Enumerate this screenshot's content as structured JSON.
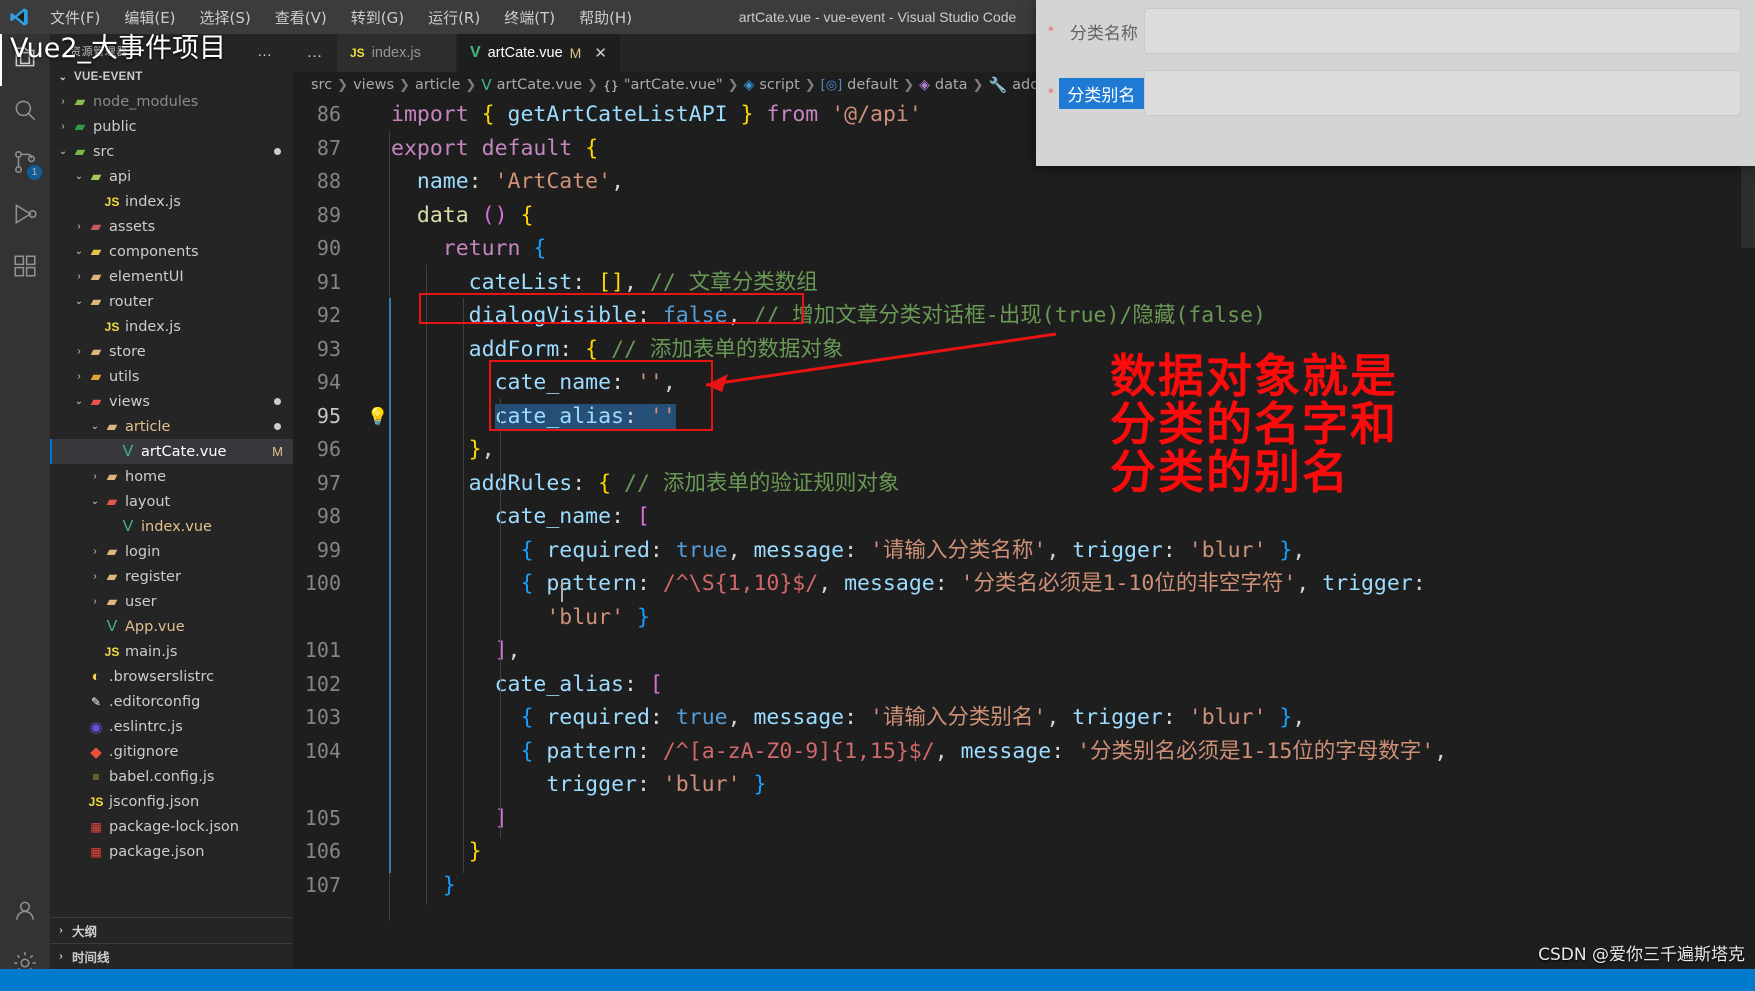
{
  "window": {
    "title": "artCate.vue - vue-event - Visual Studio Code",
    "logo_icon": "vscode-logo-icon"
  },
  "menubar": {
    "items": [
      {
        "label": "文件(F)",
        "name": "menu-file"
      },
      {
        "label": "编辑(E)",
        "name": "menu-edit"
      },
      {
        "label": "选择(S)",
        "name": "menu-selection"
      },
      {
        "label": "查看(V)",
        "name": "menu-view"
      },
      {
        "label": "转到(G)",
        "name": "menu-goto"
      },
      {
        "label": "运行(R)",
        "name": "menu-run"
      },
      {
        "label": "终端(T)",
        "name": "menu-terminal"
      },
      {
        "label": "帮助(H)",
        "name": "menu-help"
      }
    ]
  },
  "activitybar": {
    "items": [
      {
        "icon": "files-explorer-icon",
        "name": "activity-explorer",
        "active": true,
        "badge": ""
      },
      {
        "icon": "search-icon",
        "name": "activity-search",
        "active": false,
        "badge": ""
      },
      {
        "icon": "source-control-icon",
        "name": "activity-source-control",
        "active": false,
        "badge": "1"
      },
      {
        "icon": "run-debug-icon",
        "name": "activity-run-debug",
        "active": false,
        "badge": ""
      },
      {
        "icon": "extensions-icon",
        "name": "activity-extensions",
        "active": false,
        "badge": ""
      }
    ],
    "bottom": [
      {
        "icon": "account-icon",
        "name": "activity-account"
      },
      {
        "icon": "gear-icon",
        "name": "activity-manage-settings"
      }
    ]
  },
  "sidebar": {
    "title": "资源管理器",
    "more_label": "…",
    "root_label": "VUE-EVENT",
    "outline_label": "大纲",
    "timeline_label": "时间线",
    "tree": [
      {
        "label": "node_modules",
        "depth": 1,
        "twisty": "›",
        "icon": "folder-node-modules-icon",
        "color": "#8bbf4d",
        "selected": false,
        "badge": "",
        "dim": true
      },
      {
        "label": "public",
        "depth": 1,
        "twisty": "›",
        "icon": "folder-public-icon",
        "color": "#2e9b4f",
        "selected": false,
        "badge": ""
      },
      {
        "label": "src",
        "depth": 1,
        "twisty": "⌄",
        "icon": "folder-src-icon",
        "color": "#7ab648",
        "selected": false,
        "badge": "●"
      },
      {
        "label": "api",
        "depth": 2,
        "twisty": "⌄",
        "icon": "folder-api-icon",
        "color": "#a3c853",
        "selected": false,
        "badge": ""
      },
      {
        "label": "index.js",
        "depth": 3,
        "twisty": "",
        "icon": "js-file-icon",
        "color": "#f1dd3f",
        "selected": false,
        "badge": ""
      },
      {
        "label": "assets",
        "depth": 2,
        "twisty": "›",
        "icon": "folder-assets-icon",
        "color": "#c75a5a",
        "selected": false,
        "badge": ""
      },
      {
        "label": "components",
        "depth": 2,
        "twisty": "⌄",
        "icon": "folder-components-icon",
        "color": "#e8c04b",
        "selected": false,
        "badge": ""
      },
      {
        "label": "elementUI",
        "depth": 2,
        "twisty": "›",
        "icon": "folder-icon",
        "color": "#dcb67a",
        "selected": false,
        "badge": ""
      },
      {
        "label": "router",
        "depth": 2,
        "twisty": "⌄",
        "icon": "folder-router-icon",
        "color": "#dcb67a",
        "selected": false,
        "badge": ""
      },
      {
        "label": "index.js",
        "depth": 3,
        "twisty": "",
        "icon": "js-file-icon",
        "color": "#f1dd3f",
        "selected": false,
        "badge": ""
      },
      {
        "label": "store",
        "depth": 2,
        "twisty": "›",
        "icon": "folder-store-icon",
        "color": "#dcb67a",
        "selected": false,
        "badge": ""
      },
      {
        "label": "utils",
        "depth": 2,
        "twisty": "›",
        "icon": "folder-utils-icon",
        "color": "#e0a33c",
        "selected": false,
        "badge": ""
      },
      {
        "label": "views",
        "depth": 2,
        "twisty": "⌄",
        "icon": "folder-views-icon",
        "color": "#e8584a",
        "selected": false,
        "badge": "●"
      },
      {
        "label": "article",
        "depth": 3,
        "twisty": "⌄",
        "icon": "folder-article-icon",
        "color": "#dcb67a",
        "selected": false,
        "badge": "●"
      },
      {
        "label": "artCate.vue",
        "depth": 4,
        "twisty": "",
        "icon": "vue-file-icon",
        "color": "#41b883",
        "selected": true,
        "badge": "M"
      },
      {
        "label": "home",
        "depth": 3,
        "twisty": "›",
        "icon": "folder-icon",
        "color": "#dcb67a",
        "selected": false,
        "badge": ""
      },
      {
        "label": "layout",
        "depth": 3,
        "twisty": "⌄",
        "icon": "folder-layout-icon",
        "color": "#e8584a",
        "selected": false,
        "badge": ""
      },
      {
        "label": "index.vue",
        "depth": 4,
        "twisty": "",
        "icon": "vue-file-icon",
        "color": "#41b883",
        "selected": false,
        "badge": ""
      },
      {
        "label": "login",
        "depth": 3,
        "twisty": "›",
        "icon": "folder-icon",
        "color": "#dcb67a",
        "selected": false,
        "badge": ""
      },
      {
        "label": "register",
        "depth": 3,
        "twisty": "›",
        "icon": "folder-icon",
        "color": "#dcb67a",
        "selected": false,
        "badge": ""
      },
      {
        "label": "user",
        "depth": 3,
        "twisty": "›",
        "icon": "folder-icon",
        "color": "#dcb67a",
        "selected": false,
        "badge": ""
      },
      {
        "label": "App.vue",
        "depth": 3,
        "twisty": "",
        "icon": "vue-file-icon",
        "color": "#41b883",
        "selected": false,
        "badge": ""
      },
      {
        "label": "main.js",
        "depth": 3,
        "twisty": "",
        "icon": "js-file-icon",
        "color": "#f1dd3f",
        "selected": false,
        "badge": ""
      },
      {
        "label": ".browserslistrc",
        "depth": 2,
        "twisty": "",
        "icon": "browserslist-icon",
        "color": "#f5d24a",
        "selected": false,
        "badge": ""
      },
      {
        "label": ".editorconfig",
        "depth": 2,
        "twisty": "",
        "icon": "editorconfig-icon",
        "color": "#ffffff",
        "selected": false,
        "badge": ""
      },
      {
        "label": ".eslintrc.js",
        "depth": 2,
        "twisty": "",
        "icon": "eslint-icon",
        "color": "#6b4dd6",
        "selected": false,
        "badge": ""
      },
      {
        "label": ".gitignore",
        "depth": 2,
        "twisty": "",
        "icon": "git-icon",
        "color": "#e8503a",
        "selected": false,
        "badge": ""
      },
      {
        "label": "babel.config.js",
        "depth": 2,
        "twisty": "",
        "icon": "babel-icon",
        "color": "#c5a32f",
        "selected": false,
        "badge": ""
      },
      {
        "label": "jsconfig.json",
        "depth": 2,
        "twisty": "",
        "icon": "js-file-icon",
        "color": "#f1dd3f",
        "selected": false,
        "badge": ""
      },
      {
        "label": "package-lock.json",
        "depth": 2,
        "twisty": "",
        "icon": "npm-icon",
        "color": "#e8443b",
        "selected": false,
        "badge": ""
      },
      {
        "label": "package.json",
        "depth": 2,
        "twisty": "",
        "icon": "npm-icon",
        "color": "#e8443b",
        "selected": false,
        "badge": ""
      }
    ]
  },
  "editor": {
    "more_label": "…",
    "tabs": [
      {
        "label": "index.js",
        "icon": "js-file-icon",
        "active": false,
        "modified": "",
        "close": ""
      },
      {
        "label": "artCate.vue",
        "icon": "vue-file-icon",
        "active": true,
        "modified": "M",
        "close": "✕"
      }
    ],
    "breadcrumb": [
      {
        "label": "src",
        "icon": ""
      },
      {
        "label": "views",
        "icon": ""
      },
      {
        "label": "article",
        "icon": ""
      },
      {
        "label": "artCate.vue",
        "icon": "vue-file-icon"
      },
      {
        "label": "\"artCate.vue\"",
        "icon": "braces-icon"
      },
      {
        "label": "script",
        "icon": "module-icon"
      },
      {
        "label": "default",
        "icon": "property-icon"
      },
      {
        "label": "data",
        "icon": "method-icon"
      },
      {
        "label": "addForm",
        "icon": "wrench-icon"
      },
      {
        "label": "",
        "icon": "wrench-icon"
      }
    ],
    "lines": [
      {
        "no": "86",
        "bulb": false
      },
      {
        "no": "87",
        "bulb": false
      },
      {
        "no": "88",
        "bulb": false
      },
      {
        "no": "89",
        "bulb": false
      },
      {
        "no": "90",
        "bulb": false
      },
      {
        "no": "91",
        "bulb": false
      },
      {
        "no": "92",
        "bulb": false
      },
      {
        "no": "93",
        "bulb": false
      },
      {
        "no": "94",
        "bulb": false
      },
      {
        "no": "95",
        "bulb": true
      },
      {
        "no": "96",
        "bulb": false
      },
      {
        "no": "97",
        "bulb": false
      },
      {
        "no": "98",
        "bulb": false
      },
      {
        "no": "99",
        "bulb": false
      },
      {
        "no": "100",
        "bulb": false
      },
      {
        "no": "",
        "bulb": false
      },
      {
        "no": "101",
        "bulb": false
      },
      {
        "no": "102",
        "bulb": false
      },
      {
        "no": "103",
        "bulb": false
      },
      {
        "no": "104",
        "bulb": false
      },
      {
        "no": "",
        "bulb": false
      },
      {
        "no": "105",
        "bulb": false
      },
      {
        "no": "106",
        "bulb": false
      },
      {
        "no": "107",
        "bulb": false
      }
    ],
    "code": {
      "l86": "import { getArtCateListAPI } from '@/api'",
      "l87": "export default {",
      "l88": "  name: 'ArtCate',",
      "l89": "  data () {",
      "l90": "    return {",
      "l91": "      cateList: [], // 文章分类数组",
      "l92": "      dialogVisible: false, // 增加文章分类对话框-出现(true)/隐藏(false)",
      "l93": "      addForm: { // 添加表单的数据对象",
      "l94": "        cate_name: '',",
      "l95": "        cate_alias: ''",
      "l96": "      },",
      "l97": "      addRules: { // 添加表单的验证规则对象",
      "l98": "        cate_name: [",
      "l99": "          { required: true, message: '请输入分类名称', trigger: 'blur' },",
      "l100": "          { pattern: /^\\S{1,10}$/, message: '分类名必须是1-10位的非空字符', trigger:",
      "l100b": "            'blur' }",
      "l101": "        ],",
      "l102": "        cate_alias: [",
      "l103": "          { required: true, message: '请输入分类别名', trigger: 'blur' },",
      "l104": "          { pattern: /^[a-zA-Z0-9]{1,15}$/, message: '分类别名必须是1-15位的字母数字',",
      "l104b": "            trigger: 'blur' }",
      "l105": "        ]",
      "l106": "      }",
      "l107": "    }"
    }
  },
  "annotations": {
    "overlay_title": "Vue2_大事件项目",
    "red_note_lines": [
      "数据对象就是",
      "分类的名字和",
      "分类的别名"
    ],
    "red_note_color": "#fb0b0b",
    "watermark": "CSDN @爱你三千遍斯塔克"
  },
  "dialog": {
    "name_star": "*",
    "name_label": "分类名称",
    "name_value": "",
    "alias_star": "*",
    "alias_label": "分类别名",
    "alias_value": ""
  }
}
